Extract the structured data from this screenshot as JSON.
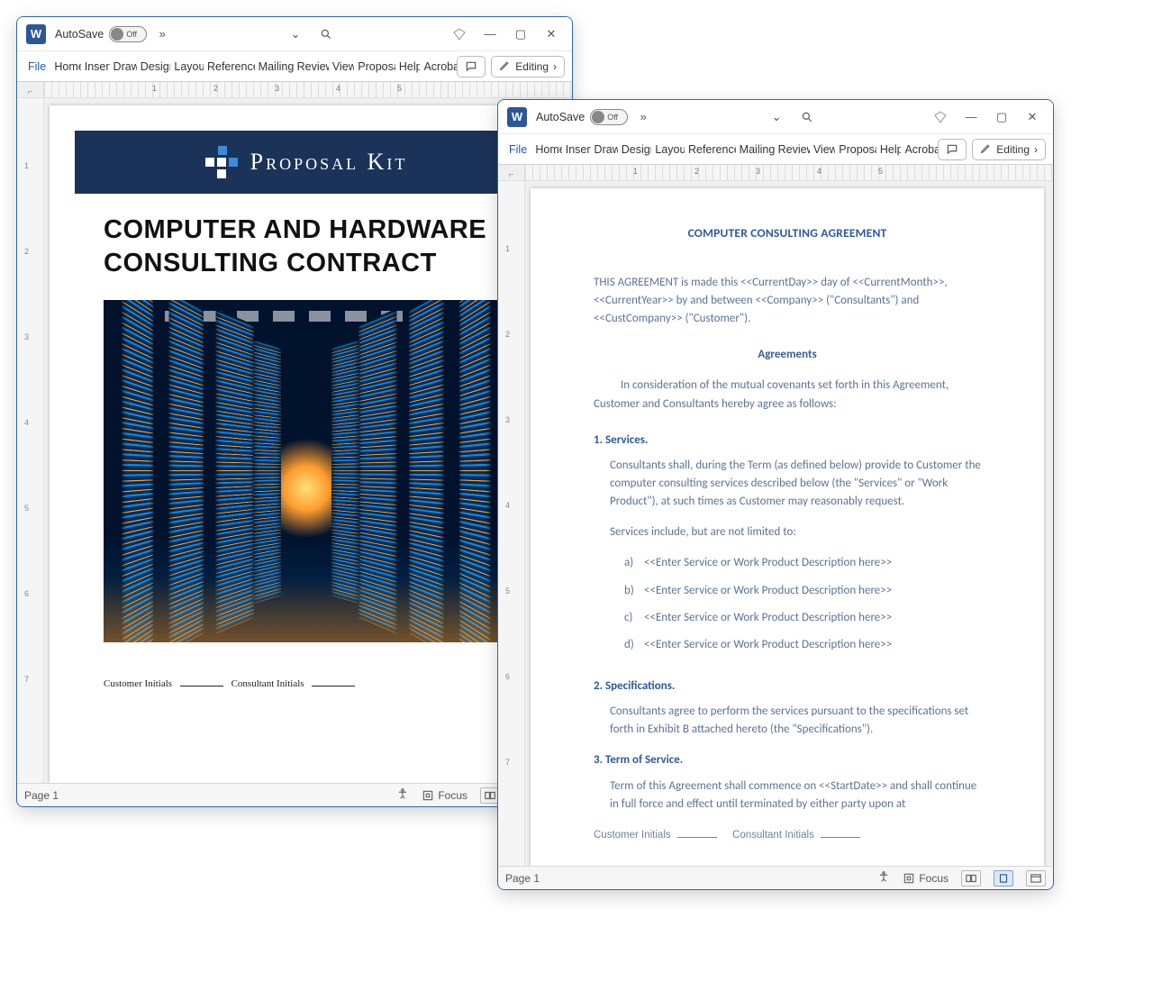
{
  "windows": [
    {
      "autosave_label": "AutoSave",
      "autosave_state": "Off",
      "ribbon_tabs": [
        "File",
        "Home",
        "Insert",
        "Draw",
        "Design",
        "Layout",
        "References",
        "Mailings",
        "Review",
        "View",
        "Proposal",
        "Help",
        "Acrobat"
      ],
      "editing_label": "Editing",
      "ruler_marks": [
        "1",
        "2",
        "3",
        "4",
        "5"
      ],
      "vruler_marks": [
        "1",
        "2",
        "3",
        "4",
        "5",
        "6",
        "7"
      ],
      "status_page": "Page 1",
      "focus_label": "Focus"
    },
    {
      "autosave_label": "AutoSave",
      "autosave_state": "Off",
      "ribbon_tabs": [
        "File",
        "Home",
        "Insert",
        "Draw",
        "Design",
        "Layout",
        "References",
        "Mailings",
        "Review",
        "View",
        "Proposal",
        "Help",
        "Acrobat"
      ],
      "editing_label": "Editing",
      "ruler_marks": [
        "1",
        "2",
        "3",
        "4",
        "5"
      ],
      "vruler_marks": [
        "1",
        "2",
        "3",
        "4",
        "5",
        "6",
        "7"
      ],
      "status_page": "Page 1",
      "focus_label": "Focus"
    }
  ],
  "doc1": {
    "banner_brand": "Proposal Kit",
    "title": "COMPUTER AND HARDWARE CONSULTING CONTRACT",
    "initials_customer": "Customer Initials",
    "initials_consultant": "Consultant Initials"
  },
  "doc2": {
    "title": "COMPUTER CONSULTING AGREEMENT",
    "intro": "THIS AGREEMENT is made this <<CurrentDay>> day of <<CurrentMonth>>, <<CurrentYear>> by and between <<Company>> (\"Consultants\") and <<CustCompany>> (\"Customer\").",
    "agreements_heading": "Agreements",
    "agreements_intro": "In consideration of the mutual covenants set forth in this Agreement, Customer and Consultants hereby agree as follows:",
    "s1_label": "1. Services.",
    "s1_p1": "Consultants shall, during the Term (as defined below) provide to Customer the computer consulting services described below (the \"Services\" or \"Work Product\"), at such times as Customer may reasonably request.",
    "s1_p2": "Services include, but are not limited to:",
    "s1_items": [
      {
        "marker": "a)",
        "text": "<<Enter Service or Work Product Description here>>"
      },
      {
        "marker": "b)",
        "text": "<<Enter Service or Work Product Description here>>"
      },
      {
        "marker": "c)",
        "text": "<<Enter Service or Work Product Description here>>"
      },
      {
        "marker": "d)",
        "text": "<<Enter Service or Work Product Description here>>"
      }
    ],
    "s2_label": "2. Specifications.",
    "s2_p1": "Consultants agree to perform the services pursuant to the specifications set forth in Exhibit B attached hereto (the \"Specifications\").",
    "s3_label": "3. Term of Service.",
    "s3_p1": "Term of this Agreement shall commence on <<StartDate>> and shall continue in full force and effect until terminated by either party upon at",
    "footer_customer": "Customer Initials",
    "footer_consultant": "Consultant Initials"
  }
}
